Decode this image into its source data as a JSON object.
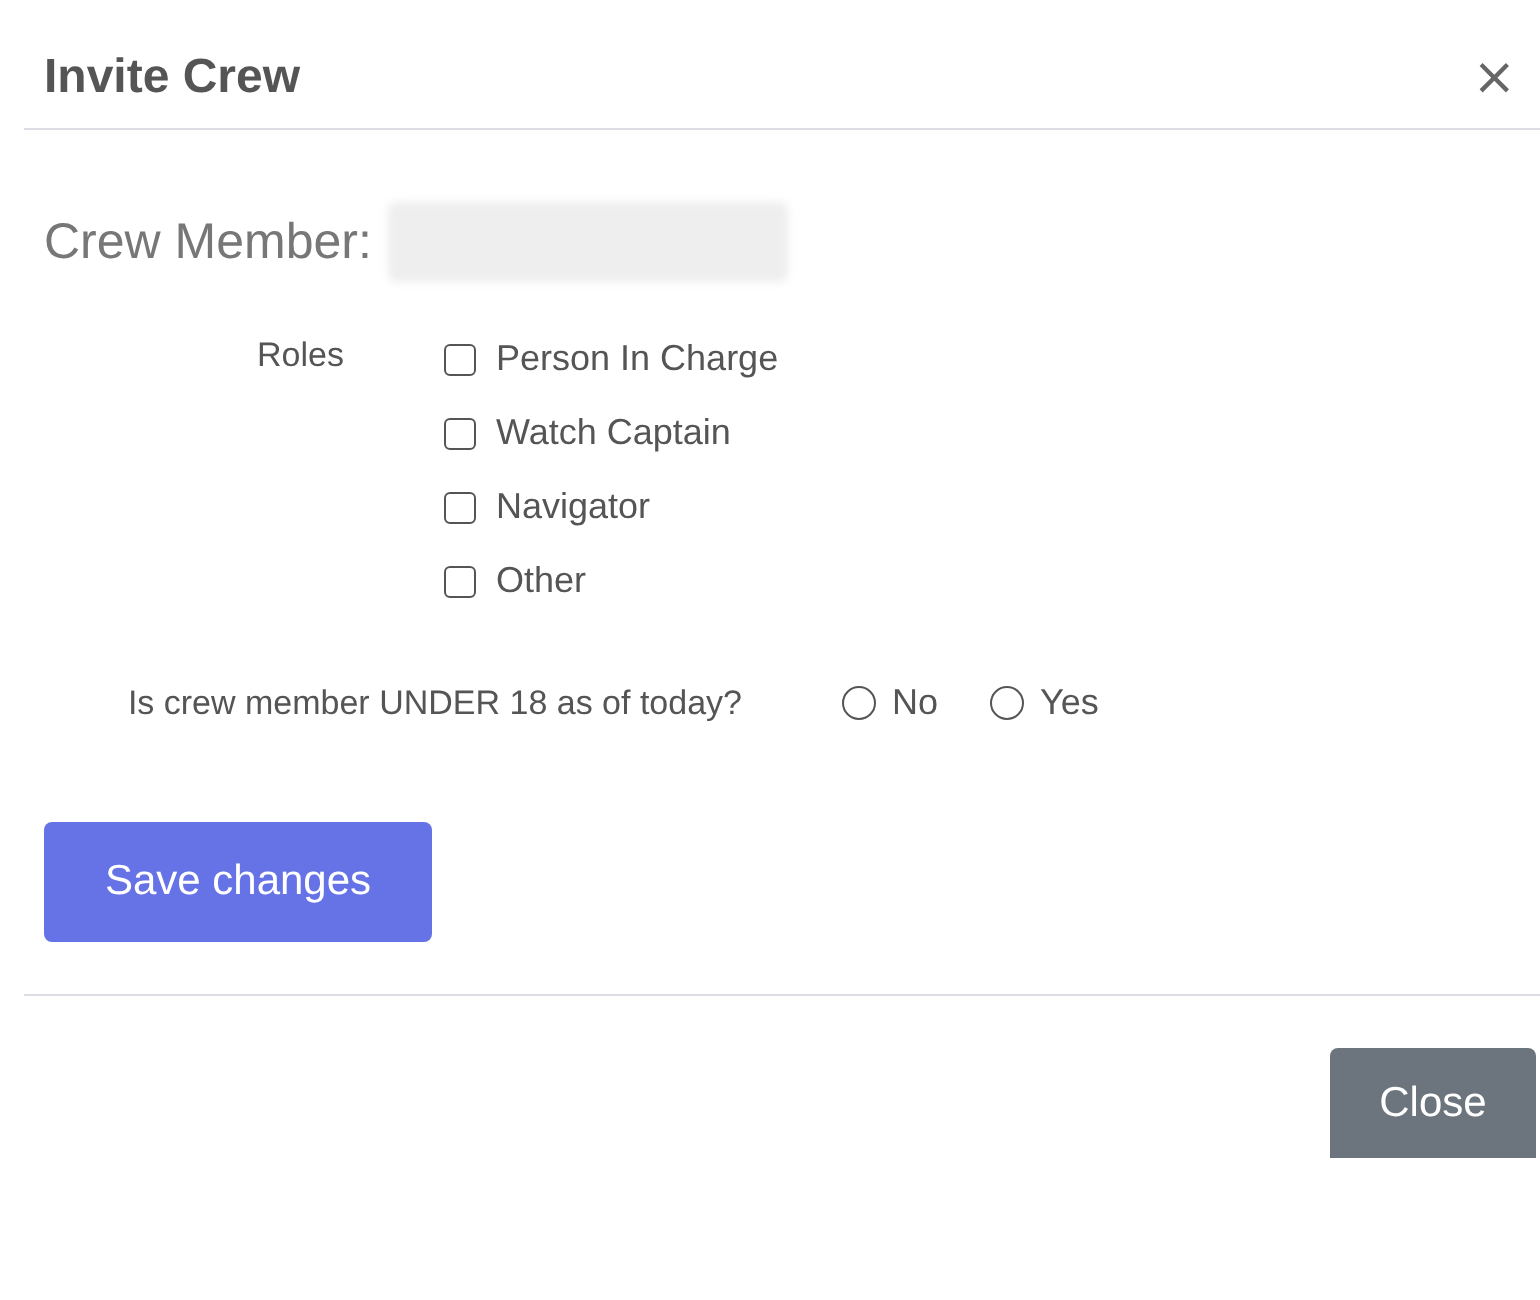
{
  "modal": {
    "title": "Invite Crew",
    "close_icon": "×"
  },
  "crew_member": {
    "label": "Crew Member:"
  },
  "roles": {
    "label": "Roles",
    "options": [
      {
        "label": "Person In Charge",
        "checked": false
      },
      {
        "label": "Watch Captain",
        "checked": false
      },
      {
        "label": "Navigator",
        "checked": false
      },
      {
        "label": "Other",
        "checked": false
      }
    ]
  },
  "under_18": {
    "question": "Is crew member UNDER 18 as of today?",
    "options": [
      {
        "label": "No",
        "selected": false
      },
      {
        "label": "Yes",
        "selected": false
      }
    ]
  },
  "buttons": {
    "save": "Save changes",
    "close": "Close"
  }
}
